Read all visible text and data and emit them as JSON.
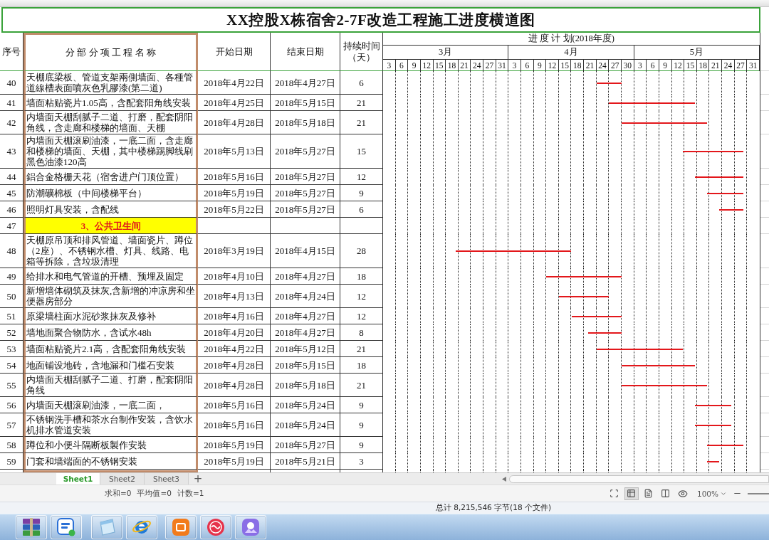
{
  "title": "XX控股X栋宿舍2-7F改造工程施工进度横道图",
  "header": {
    "index": "序号",
    "name": "分 部 分 项 工 程 名 称",
    "start": "开始日期",
    "end": "结束日期",
    "duration": "持续时间（天）"
  },
  "schedule": {
    "title": "进 度 计 划(2018年度)",
    "months": [
      {
        "label": "3月",
        "days": [
          "3",
          "6",
          "9",
          "12",
          "15",
          "18",
          "21",
          "24",
          "27",
          "31"
        ]
      },
      {
        "label": "4月",
        "days": [
          "3",
          "6",
          "9",
          "12",
          "15",
          "18",
          "21",
          "24",
          "27",
          "30"
        ]
      },
      {
        "label": "5月",
        "days": [
          "3",
          "6",
          "9",
          "12",
          "15",
          "18",
          "21",
          "24",
          "27",
          "31"
        ]
      }
    ]
  },
  "rows": [
    {
      "kind": "task",
      "no": "40",
      "name": "天棚底梁板、管道支架兩側墙面、各種管道線槽表面噴灰色乳膠漆(第二道)",
      "start": "2018年4月22日",
      "end": "2018年4月27日",
      "duration": "6"
    },
    {
      "kind": "task",
      "no": "41",
      "name": "墙面粘贴瓷片1.05高，含配套阳角线安装",
      "start": "2018年4月25日",
      "end": "2018年5月15日",
      "duration": "21"
    },
    {
      "kind": "task",
      "no": "42",
      "name": "内墙面天棚刮腻子二道、打磨，配套阴阳角线，含走廊和楼梯的墙面、天棚",
      "start": "2018年4月28日",
      "end": "2018年5月18日",
      "duration": "21"
    },
    {
      "kind": "task",
      "no": "43",
      "name": "内墙面天棚滚刷油漆，一底二面，含走廊和楼梯的墙面、天棚，其中楼梯踢脚线刷黑色油漆120高",
      "start": "2018年5月13日",
      "end": "2018年5月27日",
      "duration": "15"
    },
    {
      "kind": "task",
      "no": "44",
      "name": "鋁合金格栅天花（宿舍进户门顶位置）",
      "start": "2018年5月16日",
      "end": "2018年5月27日",
      "duration": "12"
    },
    {
      "kind": "task",
      "no": "45",
      "name": "防潮礦棉板（中间楼梯平台）",
      "start": "2018年5月19日",
      "end": "2018年5月27日",
      "duration": "9"
    },
    {
      "kind": "task",
      "no": "46",
      "name": "照明灯具安装，含配线",
      "start": "2018年5月22日",
      "end": "2018年5月27日",
      "duration": "6"
    },
    {
      "kind": "section",
      "no": "47",
      "name": "3、公共卫生间"
    },
    {
      "kind": "task",
      "no": "48",
      "name": "天棚原吊顶和排风管道、墙面瓷片、蹲位（2座）、不锈钢水槽、灯具、线路、电箱等拆除，含垃圾清理",
      "start": "2018年3月19日",
      "end": "2018年4月15日",
      "duration": "28"
    },
    {
      "kind": "task",
      "no": "49",
      "name": "给排水和电气管道的开槽、预埋及固定",
      "start": "2018年4月10日",
      "end": "2018年4月27日",
      "duration": "18"
    },
    {
      "kind": "task",
      "no": "50",
      "name": "新增墙体砌筑及抹灰,含新增的冲凉房和坐便器房部分",
      "start": "2018年4月13日",
      "end": "2018年4月24日",
      "duration": "12"
    },
    {
      "kind": "task",
      "no": "51",
      "name": "原梁墙柱面水泥砂浆抹灰及修补",
      "start": "2018年4月16日",
      "end": "2018年4月27日",
      "duration": "12"
    },
    {
      "kind": "task",
      "no": "52",
      "name": "墙地面聚合物防水，含试水48h",
      "start": "2018年4月20日",
      "end": "2018年4月27日",
      "duration": "8"
    },
    {
      "kind": "task",
      "no": "53",
      "name": "墙面粘贴瓷片2.1高，含配套阳角线安装",
      "start": "2018年4月22日",
      "end": "2018年5月12日",
      "duration": "21"
    },
    {
      "kind": "task",
      "no": "54",
      "name": "地面铺设地砖，含地漏和门槛石安装",
      "start": "2018年4月28日",
      "end": "2018年5月15日",
      "duration": "18"
    },
    {
      "kind": "task",
      "no": "55",
      "name": "内墙面天棚刮腻子二道、打磨，配套阴阳角线",
      "start": "2018年4月28日",
      "end": "2018年5月18日",
      "duration": "21"
    },
    {
      "kind": "task",
      "no": "56",
      "name": "内墙面天棚滚刷油漆，一底二面，",
      "start": "2018年5月16日",
      "end": "2018年5月24日",
      "duration": "9"
    },
    {
      "kind": "task",
      "no": "57",
      "name": "不锈钢洗手槽和茶水台制作安装，含饮水机排水管道安装",
      "start": "2018年5月16日",
      "end": "2018年5月24日",
      "duration": "9"
    },
    {
      "kind": "task",
      "no": "58",
      "name": "蹲位和小便斗隔断板製作安裝",
      "start": "2018年5月19日",
      "end": "2018年5月27日",
      "duration": "9"
    },
    {
      "kind": "task",
      "no": "59",
      "name": "门套和墙端面的不锈钢安装",
      "start": "2018年5月19日",
      "end": "2018年5月21日",
      "duration": "3"
    }
  ],
  "sheet_tabs": [
    {
      "label": "Sheet1",
      "selected": true
    },
    {
      "label": "Sheet2",
      "selected": false
    },
    {
      "label": "Sheet3",
      "selected": false
    }
  ],
  "add_sheet": "+",
  "status_bar": {
    "stats": [
      "求和=0",
      "平均值=0",
      "计数=1"
    ],
    "view_buttons": [
      {
        "kind": "fullscreen",
        "selected": false
      },
      {
        "kind": "normal",
        "selected": true
      },
      {
        "kind": "page-break",
        "selected": false
      },
      {
        "kind": "split",
        "selected": false
      },
      {
        "kind": "reading",
        "selected": false
      }
    ],
    "zoom": "100%"
  },
  "explorer_status": "总计 8,215,546 字节(18 个文件)"
}
